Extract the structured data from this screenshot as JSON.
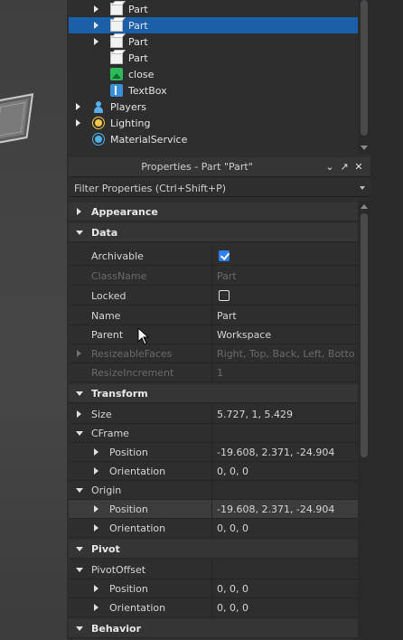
{
  "explorer": {
    "items": [
      {
        "label": "Part",
        "icon": "part-cube-icon",
        "expandable": true,
        "selected": false
      },
      {
        "label": "Part",
        "icon": "part-cube-icon",
        "expandable": true,
        "selected": true
      },
      {
        "label": "Part",
        "icon": "part-cube-icon",
        "expandable": true,
        "selected": false
      },
      {
        "label": "Part",
        "icon": "part-cube-icon",
        "expandable": false,
        "selected": false
      },
      {
        "label": "close",
        "icon": "image-button-icon",
        "expandable": false,
        "selected": false
      },
      {
        "label": "TextBox",
        "icon": "textbox-icon",
        "expandable": false,
        "selected": false
      },
      {
        "label": "Players",
        "icon": "players-icon",
        "expandable": true,
        "selected": false
      },
      {
        "label": "Lighting",
        "icon": "lighting-icon",
        "expandable": true,
        "selected": false
      },
      {
        "label": "MaterialService",
        "icon": "material-service-icon",
        "expandable": false,
        "selected": false
      }
    ]
  },
  "properties": {
    "title": "Properties - Part \"Part\"",
    "filter_placeholder": "Filter Properties (Ctrl+Shift+P)",
    "rows": [
      {
        "kind": "category",
        "name": "Appearance",
        "expanded": false
      },
      {
        "kind": "category",
        "name": "Data",
        "expanded": true
      },
      {
        "kind": "prop",
        "name": "Archivable",
        "checkbox": true,
        "checked": true
      },
      {
        "kind": "prop",
        "name": "ClassName",
        "value": "Part",
        "disabled": true
      },
      {
        "kind": "prop",
        "name": "Locked",
        "checkbox": true,
        "checked": false
      },
      {
        "kind": "prop",
        "name": "Name",
        "value": "Part"
      },
      {
        "kind": "prop",
        "name": "Parent",
        "value": "Workspace"
      },
      {
        "kind": "prop",
        "name": "ResizeableFaces",
        "value": "Right, Top, Back, Left, Botto...",
        "disabled": true,
        "expandable": true
      },
      {
        "kind": "prop",
        "name": "ResizeIncrement",
        "value": "1",
        "disabled": true
      },
      {
        "kind": "category",
        "name": "Transform",
        "expanded": true
      },
      {
        "kind": "prop",
        "name": "Size",
        "value": "5.727, 1, 5.429",
        "expandable": true
      },
      {
        "kind": "prop",
        "name": "CFrame",
        "expanded": true
      },
      {
        "kind": "sub",
        "name": "Position",
        "value": "-19.608, 2.371, -24.904"
      },
      {
        "kind": "sub",
        "name": "Orientation",
        "value": "0, 0, 0"
      },
      {
        "kind": "prop",
        "name": "Origin",
        "expanded": true
      },
      {
        "kind": "sub",
        "name": "Position",
        "value": "-19.608, 2.371, -24.904",
        "highlight": true
      },
      {
        "kind": "sub",
        "name": "Orientation",
        "value": "0, 0, 0"
      },
      {
        "kind": "category",
        "name": "Pivot",
        "expanded": true
      },
      {
        "kind": "prop",
        "name": "PivotOffset",
        "expanded": true
      },
      {
        "kind": "sub",
        "name": "Position",
        "value": "0, 0, 0"
      },
      {
        "kind": "sub",
        "name": "Orientation",
        "value": "0, 0, 0"
      },
      {
        "kind": "category",
        "name": "Behavior",
        "expanded": true
      }
    ]
  }
}
